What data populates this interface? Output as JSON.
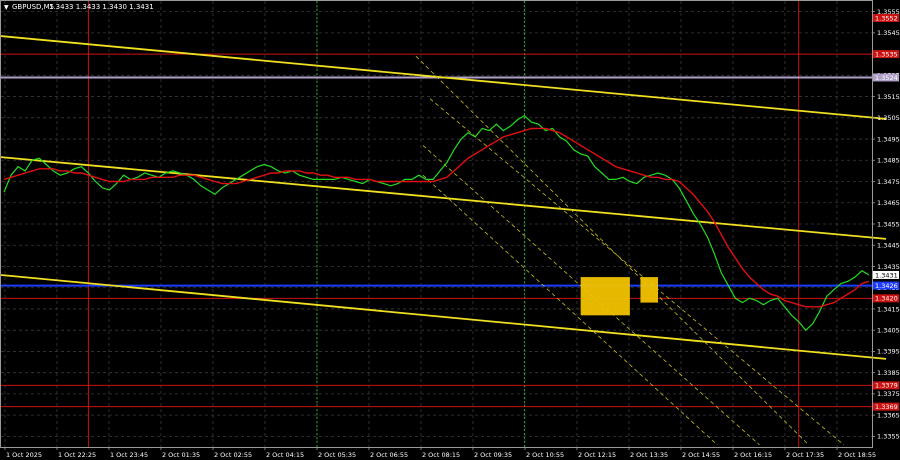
{
  "chart_data": {
    "type": "line",
    "title": "GBPUSD,M5",
    "ohlc_readout": "1.3433 1.3433 1.3430 1.3431",
    "ylim": [
      1.335,
      1.356
    ],
    "price_ticks": [
      "1.3555",
      "1.3545",
      "1.3535",
      "1.3525",
      "1.3515",
      "1.3505",
      "1.3495",
      "1.3485",
      "1.3475",
      "1.3465",
      "1.3455",
      "1.3445",
      "1.3435",
      "1.3425",
      "1.3415",
      "1.3405",
      "1.3395",
      "1.3385",
      "1.3375",
      "1.3365",
      "1.3355"
    ],
    "time_ticks": [
      "1 Oct 2025",
      "1 Oct 22:25",
      "1 Oct 23:45",
      "2 Oct 01:35",
      "2 Oct 02:55",
      "2 Oct 04:15",
      "2 Oct 05:35",
      "2 Oct 06:55",
      "2 Oct 08:15",
      "2 Oct 09:35",
      "2 Oct 10:55",
      "2 Oct 12:15",
      "2 Oct 13:35",
      "2 Oct 14:55",
      "2 Oct 16:15",
      "2 Oct 17:35",
      "2 Oct 18:55"
    ],
    "price_labels": [
      {
        "text": "1.3552",
        "price": 1.3552,
        "color": "#cc1111"
      },
      {
        "text": "1.3535",
        "price": 1.3535,
        "color": "#cc1111"
      },
      {
        "text": "1.3524",
        "price": 1.3524,
        "color": "#b0a0c8"
      },
      {
        "text": "1.3431",
        "price": 1.3431,
        "color": "#ffffff"
      },
      {
        "text": "1.3426",
        "price": 1.3426,
        "color": "#1e3cff"
      },
      {
        "text": "1.3420",
        "price": 1.342,
        "color": "#cc1111"
      },
      {
        "text": "1.3379",
        "price": 1.3379,
        "color": "#cc1111"
      },
      {
        "text": "1.3369",
        "price": 1.3369,
        "color": "#cc1111"
      }
    ],
    "horizontal_levels": [
      {
        "price": 1.3535,
        "color": "#cc1111"
      },
      {
        "price": 1.3524,
        "color": "#b0a0c8"
      },
      {
        "price": 1.3426,
        "color": "#1e3cff"
      },
      {
        "price": 1.342,
        "color": "#cc1111"
      },
      {
        "price": 1.3379,
        "color": "#cc1111"
      },
      {
        "price": 1.3369,
        "color": "#cc1111"
      }
    ],
    "series": [
      {
        "color": "#22dd22",
        "values": [
          1.347,
          1.3478,
          1.3482,
          1.348,
          1.3485,
          1.3486,
          1.3483,
          1.348,
          1.3478,
          1.3479,
          1.3481,
          1.3482,
          1.3479,
          1.3475,
          1.3472,
          1.3471,
          1.3474,
          1.3478,
          1.3476,
          1.3477,
          1.3479,
          1.3478,
          1.3477,
          1.3479,
          1.348,
          1.3479,
          1.3478,
          1.3476,
          1.3473,
          1.3471,
          1.3469,
          1.3472,
          1.3474,
          1.3476,
          1.3478,
          1.348,
          1.3482,
          1.3483,
          1.3482,
          1.348,
          1.3479,
          1.348,
          1.3478,
          1.3477,
          1.3476,
          1.3476,
          1.3476,
          1.3476,
          1.3477,
          1.3476,
          1.3475,
          1.3474,
          1.3476,
          1.3475,
          1.3474,
          1.3473,
          1.3474,
          1.3476,
          1.3476,
          1.3478,
          1.3476,
          1.3476,
          1.348,
          1.3484,
          1.349,
          1.3495,
          1.3498,
          1.3496,
          1.35,
          1.3499,
          1.3502,
          1.3499,
          1.3501,
          1.3504,
          1.3506,
          1.3503,
          1.3502,
          1.3499,
          1.35,
          1.3496,
          1.3494,
          1.349,
          1.3488,
          1.3487,
          1.3482,
          1.3479,
          1.3476,
          1.3476,
          1.3477,
          1.3475,
          1.3474,
          1.3477,
          1.3478,
          1.3479,
          1.3478,
          1.3476,
          1.3472,
          1.3466,
          1.346,
          1.3455,
          1.3449,
          1.3441,
          1.3432,
          1.3426,
          1.342,
          1.3418,
          1.342,
          1.3419,
          1.3417,
          1.3419,
          1.342,
          1.3416,
          1.3412,
          1.3409,
          1.3405,
          1.3408,
          1.3414,
          1.3421,
          1.3424,
          1.3427,
          1.3428,
          1.343,
          1.3433,
          1.3431
        ]
      },
      {
        "color": "#e01010",
        "values": [
          1.3476,
          1.3477,
          1.3478,
          1.3479,
          1.348,
          1.3481,
          1.3481,
          1.3481,
          1.348,
          1.348,
          1.3479,
          1.3479,
          1.3478,
          1.3477,
          1.3476,
          1.3475,
          1.3475,
          1.3475,
          1.3476,
          1.3476,
          1.3476,
          1.3477,
          1.3477,
          1.3477,
          1.3477,
          1.3478,
          1.3478,
          1.3478,
          1.3477,
          1.3476,
          1.3475,
          1.3474,
          1.3474,
          1.3474,
          1.3475,
          1.3476,
          1.3477,
          1.3478,
          1.3479,
          1.3479,
          1.348,
          1.348,
          1.348,
          1.3479,
          1.3479,
          1.3478,
          1.3478,
          1.3477,
          1.3477,
          1.3477,
          1.3476,
          1.3476,
          1.3476,
          1.3475,
          1.3475,
          1.3475,
          1.3475,
          1.3475,
          1.3475,
          1.3475,
          1.3475,
          1.3475,
          1.3476,
          1.3477,
          1.348,
          1.3483,
          1.3486,
          1.3488,
          1.349,
          1.3492,
          1.3494,
          1.3496,
          1.3497,
          1.3498,
          1.3499,
          1.35,
          1.35,
          1.35,
          1.3499,
          1.3498,
          1.3496,
          1.3494,
          1.3492,
          1.349,
          1.3488,
          1.3486,
          1.3484,
          1.3482,
          1.3481,
          1.348,
          1.3479,
          1.3478,
          1.3477,
          1.3477,
          1.3476,
          1.3476,
          1.3475,
          1.3472,
          1.3469,
          1.3465,
          1.3461,
          1.3456,
          1.345,
          1.3444,
          1.3439,
          1.3434,
          1.343,
          1.3427,
          1.3424,
          1.3422,
          1.3421,
          1.3419,
          1.3418,
          1.3417,
          1.3416,
          1.3416,
          1.3416,
          1.3417,
          1.3418,
          1.342,
          1.3422,
          1.3424,
          1.3427,
          1.3428
        ]
      }
    ],
    "trend_lines": [
      {
        "color": "#f0e020",
        "width": 1.8,
        "x": [
          0,
          125
        ],
        "y": [
          1.35435,
          1.35045
        ],
        "dash": false
      },
      {
        "color": "#f0e020",
        "width": 1.8,
        "x": [
          0,
          125
        ],
        "y": [
          1.34865,
          1.3448
        ],
        "dash": false
      },
      {
        "color": "#f0e020",
        "width": 1.8,
        "x": [
          0,
          125
        ],
        "y": [
          1.3431,
          1.33915
        ],
        "dash": false
      },
      {
        "color": "#c8bc20",
        "width": 0.8,
        "x": [
          59,
          114
        ],
        "y": [
          1.3534,
          1.3351
        ],
        "dash": true
      },
      {
        "color": "#c8bc20",
        "width": 0.8,
        "x": [
          61,
          119
        ],
        "y": [
          1.3514,
          1.3351
        ],
        "dash": true
      },
      {
        "color": "#c8bc20",
        "width": 0.8,
        "x": [
          60,
          107
        ],
        "y": [
          1.3492,
          1.3351
        ],
        "dash": true
      },
      {
        "color": "#c8bc20",
        "width": 0.8,
        "x": [
          60,
          101
        ],
        "y": [
          1.3478,
          1.3351
        ],
        "dash": true
      }
    ],
    "vertical_lines": [
      {
        "bar": 12,
        "color": "#cc1111",
        "style": "solid"
      },
      {
        "bar": 44.5,
        "color": "#22aa22",
        "style": "dotted"
      },
      {
        "bar": 74,
        "color": "#22aa22",
        "style": "dotted"
      },
      {
        "bar": 113,
        "color": "#cc1111",
        "style": "solid"
      }
    ],
    "highlight_boxes": [
      {
        "x": [
          82,
          89
        ],
        "y": [
          1.3412,
          1.343
        ],
        "color": "#f2c200"
      },
      {
        "x": [
          90.5,
          93
        ],
        "y": [
          1.3418,
          1.343
        ],
        "color": "#f2c200"
      }
    ],
    "grid": true
  }
}
